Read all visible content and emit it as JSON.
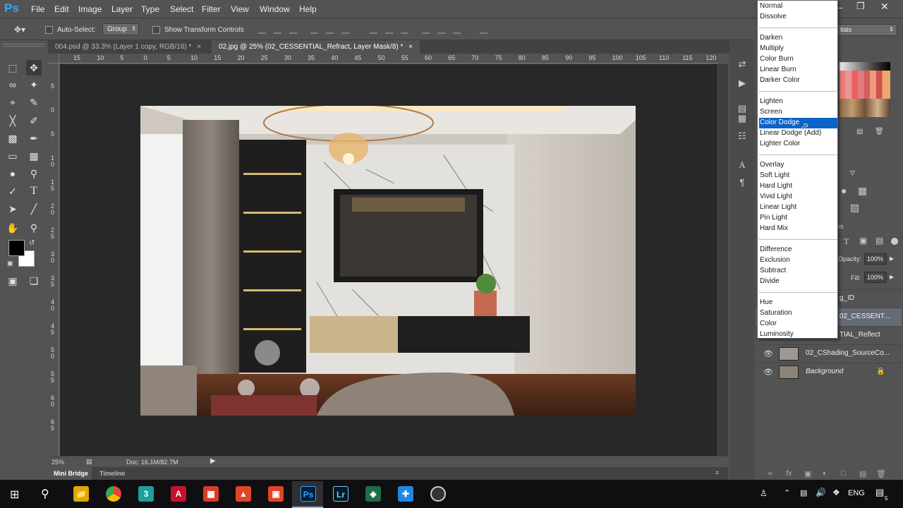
{
  "app": {
    "logo": "Ps"
  },
  "menu": [
    "File",
    "Edit",
    "Image",
    "Layer",
    "Type",
    "Select",
    "Filter",
    "View",
    "Window",
    "Help"
  ],
  "options": {
    "auto_select_label": "Auto-Select:",
    "auto_select_value": "Group",
    "transform_label": "Show Transform Controls",
    "workspace_fragment": "tials"
  },
  "tabs": [
    {
      "label": "004.psd @ 33.3% (Layer 1 copy, RGB/16) *",
      "close": "×"
    },
    {
      "label": "02.jpg @ 25% (02_CESSENTIAL_Refract, Layer Mask/8) *",
      "close": "×"
    }
  ],
  "ruler": {
    "top": [
      "15",
      "10",
      "5",
      "0",
      "5",
      "10",
      "15",
      "20",
      "25",
      "30",
      "35",
      "40",
      "45",
      "50",
      "55",
      "60",
      "65",
      "70",
      "75",
      "80",
      "85",
      "90",
      "95",
      "100",
      "105",
      "110",
      "115",
      "120"
    ],
    "left": [
      "5",
      "0",
      "5",
      "1 0",
      "1 5",
      "2 0",
      "2 5",
      "3 0",
      "3 5",
      "4 0",
      "4 5",
      "5 0",
      "5 5",
      "6 0",
      "6 5"
    ]
  },
  "status": {
    "zoom": "25%",
    "doc": "Doc: 16.1M/82.7M"
  },
  "bottom_tabs": [
    "Mini Bridge",
    "Timeline"
  ],
  "blend_modes": [
    [
      "Normal",
      "Dissolve"
    ],
    [
      "Darken",
      "Multiply",
      "Color Burn",
      "Linear Burn",
      "Darker Color"
    ],
    [
      "Lighten",
      "Screen",
      "Color Dodge",
      "Linear Dodge (Add)",
      "Lighter Color"
    ],
    [
      "Overlay",
      "Soft Light",
      "Hard Light",
      "Vivid Light",
      "Linear Light",
      "Pin Light",
      "Hard Mix"
    ],
    [
      "Difference",
      "Exclusion",
      "Subtract",
      "Divide"
    ],
    [
      "Hue",
      "Saturation",
      "Color",
      "Luminosity"
    ]
  ],
  "selected_blend_mode": "Color Dodge",
  "layers_panel": {
    "tab_fragment": "es",
    "opacity_label": "Opacity:",
    "opacity_value": "100%",
    "fill_label": "Fill:",
    "fill_value": "100%",
    "layers": [
      {
        "name": "g_ID"
      },
      {
        "name": "02_CESSENT..."
      },
      {
        "name": "TIAL_Reflect"
      },
      {
        "name": "02_CShading_SourceCo..."
      },
      {
        "name": "Background"
      }
    ]
  },
  "taskbar": {
    "lang": "ENG",
    "notifications": "5"
  },
  "colors": {
    "ui_bg": "#535353",
    "canvas_bg": "#282828",
    "selection": "#0a64c8",
    "ps_blue": "#31a8ff"
  }
}
